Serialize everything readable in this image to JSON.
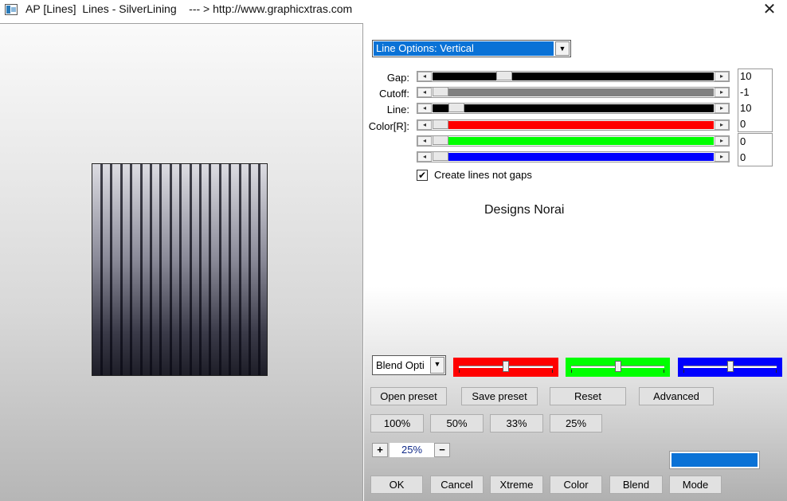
{
  "window": {
    "title": "AP [Lines]  Lines - SilverLining    --- > http://www.graphicxtras.com"
  },
  "controls": {
    "line_options": {
      "selected": "Line Options: Vertical"
    },
    "sliders": [
      {
        "label": "Gap:",
        "value": "10",
        "fill": "#000000",
        "level": 0.24
      },
      {
        "label": "Cutoff:",
        "value": "-1",
        "fill": "#808080",
        "level": 0.0
      },
      {
        "label": "Line:",
        "value": "10",
        "fill": "#000000",
        "level": 0.06
      },
      {
        "label": "Color[R]:",
        "value": "0",
        "fill": "#ff0000",
        "level": 0.0
      },
      {
        "label": "",
        "value": "0",
        "fill": "#00ff00",
        "level": 0.0
      },
      {
        "label": "",
        "value": "0",
        "fill": "#0000ff",
        "level": 0.0
      }
    ],
    "create_lines": {
      "label": "Create lines not gaps",
      "checked": true
    },
    "credit": "Designs Norai",
    "blend_options": {
      "selected": "Blend Opti"
    },
    "color_sliders": [
      {
        "color": "#ff0000",
        "level": 0.5
      },
      {
        "color": "#00ff00",
        "level": 0.5
      },
      {
        "color": "#0000ff",
        "level": 0.5
      }
    ],
    "buttons": {
      "open_preset": "Open preset",
      "save_preset": "Save preset",
      "reset": "Reset",
      "advanced": "Advanced",
      "zoom_100": "100%",
      "zoom_50": "50%",
      "zoom_33": "33%",
      "zoom_25": "25%",
      "ok": "OK",
      "cancel": "Cancel",
      "xtreme": "Xtreme",
      "color": "Color",
      "blend": "Blend",
      "mode": "Mode"
    },
    "zoom": {
      "plus": "+",
      "value": "25%",
      "minus": "−"
    },
    "accent_color": "#0a72d6"
  },
  "icons": {
    "close": "✕",
    "dropdown_arrow": "▼",
    "slider_left": "◂",
    "slider_right": "▸",
    "check": "✔"
  }
}
